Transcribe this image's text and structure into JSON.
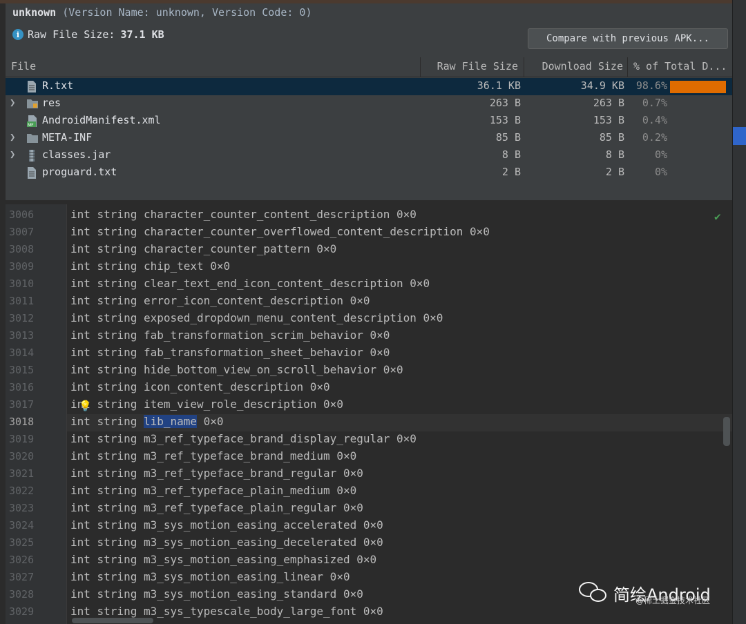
{
  "header": {
    "app_name": "unknown",
    "version_info": "(Version Name: unknown, Version Code: 0)",
    "raw_size_label": "Raw File Size:",
    "raw_size_value": "37.1 KB",
    "compare_button": "Compare with previous APK..."
  },
  "table": {
    "columns": [
      "File",
      "Raw File Size",
      "Download Size",
      "% of Total D..."
    ],
    "rows": [
      {
        "name": "R.txt",
        "raw": "36.1 KB",
        "download": "34.9 KB",
        "pct": "98.6%",
        "bar_fraction": 0.986,
        "expandable": false,
        "icon": "text-file-icon",
        "selected": true
      },
      {
        "name": "res",
        "raw": "263 B",
        "download": "263 B",
        "pct": "0.7%",
        "bar_fraction": 0.007,
        "expandable": true,
        "icon": "resource-folder-icon",
        "selected": false
      },
      {
        "name": "AndroidManifest.xml",
        "raw": "153 B",
        "download": "153 B",
        "pct": "0.4%",
        "bar_fraction": 0.004,
        "expandable": false,
        "icon": "manifest-file-icon",
        "selected": false
      },
      {
        "name": "META-INF",
        "raw": "85 B",
        "download": "85 B",
        "pct": "0.2%",
        "bar_fraction": 0.002,
        "expandable": true,
        "icon": "folder-icon",
        "selected": false
      },
      {
        "name": "classes.jar",
        "raw": "8 B",
        "download": "8 B",
        "pct": "0%",
        "bar_fraction": 0,
        "expandable": true,
        "icon": "jar-file-icon",
        "selected": false
      },
      {
        "name": "proguard.txt",
        "raw": "2 B",
        "download": "2 B",
        "pct": "0%",
        "bar_fraction": 0,
        "expandable": false,
        "icon": "text-file-icon",
        "selected": false
      }
    ]
  },
  "editor": {
    "current_line": "3018",
    "selected_text": "lib_name",
    "lines": [
      {
        "no": "3006",
        "text": "int string character_counter_content_description 0×0"
      },
      {
        "no": "3007",
        "text": "int string character_counter_overflowed_content_description 0×0"
      },
      {
        "no": "3008",
        "text": "int string character_counter_pattern 0×0"
      },
      {
        "no": "3009",
        "text": "int string chip_text 0×0"
      },
      {
        "no": "3010",
        "text": "int string clear_text_end_icon_content_description 0×0"
      },
      {
        "no": "3011",
        "text": "int string error_icon_content_description 0×0"
      },
      {
        "no": "3012",
        "text": "int string exposed_dropdown_menu_content_description 0×0"
      },
      {
        "no": "3013",
        "text": "int string fab_transformation_scrim_behavior 0×0"
      },
      {
        "no": "3014",
        "text": "int string fab_transformation_sheet_behavior 0×0"
      },
      {
        "no": "3015",
        "text": "int string hide_bottom_view_on_scroll_behavior 0×0"
      },
      {
        "no": "3016",
        "text": "int string icon_content_description 0×0"
      },
      {
        "no": "3017",
        "text": "int string item_view_role_description 0×0"
      },
      {
        "no": "3018",
        "text_before": "int string ",
        "text_selected": "lib_name",
        "text_after": " 0×0"
      },
      {
        "no": "3019",
        "text": "int string m3_ref_typeface_brand_display_regular 0×0"
      },
      {
        "no": "3020",
        "text": "int string m3_ref_typeface_brand_medium 0×0"
      },
      {
        "no": "3021",
        "text": "int string m3_ref_typeface_brand_regular 0×0"
      },
      {
        "no": "3022",
        "text": "int string m3_ref_typeface_plain_medium 0×0"
      },
      {
        "no": "3023",
        "text": "int string m3_ref_typeface_plain_regular 0×0"
      },
      {
        "no": "3024",
        "text": "int string m3_sys_motion_easing_accelerated 0×0"
      },
      {
        "no": "3025",
        "text": "int string m3_sys_motion_easing_decelerated 0×0"
      },
      {
        "no": "3026",
        "text": "int string m3_sys_motion_easing_emphasized 0×0"
      },
      {
        "no": "3027",
        "text": "int string m3_sys_motion_easing_linear 0×0"
      },
      {
        "no": "3028",
        "text": "int string m3_sys_motion_easing_standard 0×0"
      },
      {
        "no": "3029",
        "text": "int string m3_sys_typescale_body_large_font 0×0"
      }
    ]
  },
  "watermark": {
    "name": "简绘Android",
    "sub": "@稀土掘金技术社区"
  },
  "colors": {
    "bar": "#e06c00",
    "selection": "#214283",
    "selected_row": "#0d293e",
    "check": "#499c54"
  },
  "icons": [
    "info-icon",
    "chevron-right-icon",
    "text-file-icon",
    "folder-icon",
    "jar-file-icon",
    "manifest-file-icon",
    "lightbulb-icon",
    "checkmark-icon"
  ]
}
